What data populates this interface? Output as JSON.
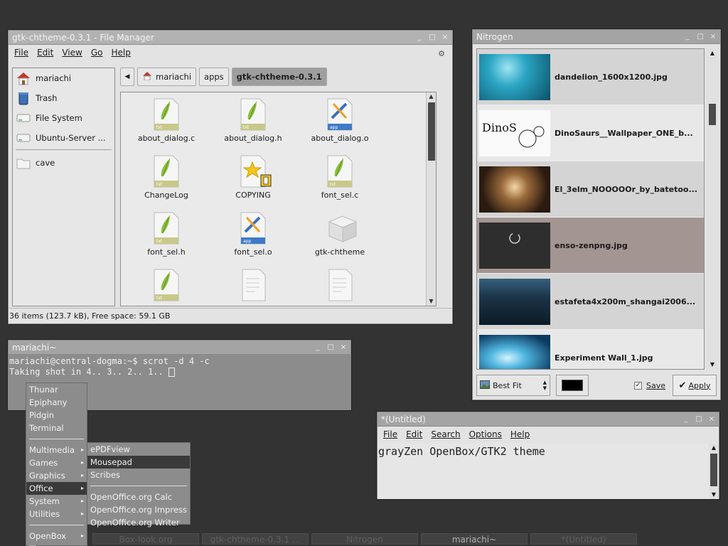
{
  "file_manager": {
    "title": "gtk-chtheme-0.3.1 - File Manager",
    "menu": [
      "File",
      "Edit",
      "View",
      "Go",
      "Help"
    ],
    "sidebar": [
      {
        "label": "mariachi",
        "icon": "home-icon"
      },
      {
        "label": "Trash",
        "icon": "trash-icon"
      },
      {
        "label": "File System",
        "icon": "drive-icon"
      },
      {
        "label": "Ubuntu-Server ...",
        "icon": "drive-icon"
      },
      {
        "label": "cave",
        "icon": "folder-icon"
      }
    ],
    "path": [
      "mariachi",
      "apps",
      "gtk-chtheme-0.3.1"
    ],
    "files": [
      {
        "name": "about_dialog.c",
        "type": "txt"
      },
      {
        "name": "about_dialog.h",
        "type": "txt"
      },
      {
        "name": "about_dialog.o",
        "type": "app"
      },
      {
        "name": "ChangeLog",
        "type": "txt"
      },
      {
        "name": "COPYING",
        "type": "star"
      },
      {
        "name": "font_sel.c",
        "type": "txt"
      },
      {
        "name": "font_sel.h",
        "type": "txt"
      },
      {
        "name": "font_sel.o",
        "type": "app"
      },
      {
        "name": "gtk-chtheme",
        "type": "block"
      },
      {
        "name": "",
        "type": "txt"
      },
      {
        "name": "",
        "type": "plain"
      },
      {
        "name": "",
        "type": "plain"
      }
    ],
    "status": "36 items (123.7 kB), Free space: 59.1 GB"
  },
  "nitrogen": {
    "title": "Nitrogen",
    "items": [
      "dandelion_1600x1200.jpg",
      "DinoSaurs__Wallpaper_ONE_b...",
      "El_3elm_NOOOOOr_by_batetoo...",
      "enso-zenpng.jpg",
      "estafeta4x200m_shangai2006...",
      "Experiment Wall_1.jpg"
    ],
    "selected_index": 3,
    "fit_mode": "Best Fit",
    "bg_color": "#000000",
    "save_label": "Save",
    "save_checked": true,
    "apply_label": "Apply"
  },
  "terminal": {
    "title": "mariachi~",
    "line1": "mariachi@central-dogma:~$ scrot -d 4 -c",
    "line2": "Taking shot in 4.. 3.. 2.. 1.. "
  },
  "mousepad": {
    "title": "*(Untitled)",
    "menu": [
      "File",
      "Edit",
      "Search",
      "Options",
      "Help"
    ],
    "content": "grayZen OpenBox/GTK2 theme"
  },
  "root_menu": {
    "items": [
      {
        "label": "Thunar"
      },
      {
        "label": "Epiphany"
      },
      {
        "label": "Pidgin"
      },
      {
        "label": "Terminal"
      },
      {
        "sep": true
      },
      {
        "label": "Multimedia",
        "sub": true
      },
      {
        "label": "Games",
        "sub": true
      },
      {
        "label": "Graphics",
        "sub": true
      },
      {
        "label": "Office",
        "sub": true,
        "hl": true
      },
      {
        "label": "System",
        "sub": true
      },
      {
        "label": "Utilities",
        "sub": true
      },
      {
        "sep": true
      },
      {
        "label": "OpenBox",
        "sub": true
      },
      {
        "label": "Time",
        "sub": true
      }
    ]
  },
  "office_menu": {
    "items": [
      {
        "label": "ePDFview"
      },
      {
        "label": "Mousepad",
        "hl": true
      },
      {
        "label": "Scribes"
      },
      {
        "sep": true
      },
      {
        "label": "OpenOffice.org Calc"
      },
      {
        "label": "OpenOffice.org Impress"
      },
      {
        "label": "OpenOffice.org Writer"
      }
    ]
  },
  "taskbar": [
    "Box-look.org",
    "gtk-chtheme-0.3.1 ...",
    "Nitrogen",
    "mariachi~",
    "*(Untitled)"
  ],
  "taskbar_active": 3,
  "window_controls": {
    "minimize": "_",
    "maximize": "□",
    "close": "×"
  }
}
